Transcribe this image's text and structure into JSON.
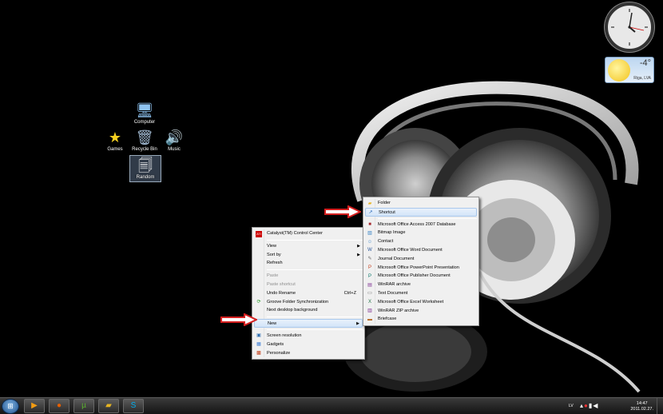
{
  "desktop": {
    "icons": [
      {
        "label": "Computer",
        "icon": "computer-icon"
      },
      {
        "label": "Games",
        "icon": "star-icon"
      },
      {
        "label": "Recycle Bin",
        "icon": "recycle-bin-icon"
      },
      {
        "label": "Music",
        "icon": "speaker-icon"
      },
      {
        "label": "Random",
        "icon": "document-stack-icon"
      }
    ]
  },
  "gadgets": {
    "weather": {
      "temperature": "-4°",
      "city": "Riga, LVA"
    }
  },
  "desktop_menu": {
    "items": [
      {
        "label": "Catalyst(TM) Control Center",
        "icon": "ati-icon"
      },
      {
        "label": "View"
      },
      {
        "label": "Sort by"
      },
      {
        "label": "Refresh"
      },
      {
        "label": "Paste"
      },
      {
        "label": "Paste shortcut"
      },
      {
        "label": "Undo Rename",
        "shortcut": "Ctrl+Z"
      },
      {
        "label": "Groove Folder Synchronization",
        "icon": "groove-icon"
      },
      {
        "label": "Next desktop background"
      },
      {
        "label": "New"
      },
      {
        "label": "Screen resolution",
        "icon": "display-icon"
      },
      {
        "label": "Gadgets",
        "icon": "gadgets-icon"
      },
      {
        "label": "Personalize",
        "icon": "personalize-icon"
      }
    ]
  },
  "new_menu": {
    "items": [
      {
        "label": "Folder",
        "icon": "folder-icon"
      },
      {
        "label": "Shortcut",
        "icon": "shortcut-icon"
      },
      {
        "label": "Microsoft Office Access 2007 Database",
        "icon": "access-icon"
      },
      {
        "label": "Bitmap Image",
        "icon": "bitmap-icon"
      },
      {
        "label": "Contact",
        "icon": "contact-icon"
      },
      {
        "label": "Microsoft Office Word Document",
        "icon": "word-icon"
      },
      {
        "label": "Journal Document",
        "icon": "journal-icon"
      },
      {
        "label": "Microsoft Office PowerPoint Presentation",
        "icon": "powerpoint-icon"
      },
      {
        "label": "Microsoft Office Publisher Document",
        "icon": "publisher-icon"
      },
      {
        "label": "WinRAR archive",
        "icon": "winrar-icon"
      },
      {
        "label": "Text Document",
        "icon": "text-icon"
      },
      {
        "label": "Microsoft Office Excel Worksheet",
        "icon": "excel-icon"
      },
      {
        "label": "WinRAR ZIP archive",
        "icon": "zip-icon"
      },
      {
        "label": "Briefcase",
        "icon": "briefcase-icon"
      }
    ]
  },
  "taskbar": {
    "language": "LV",
    "time": "14:47",
    "date": "2011.02.27."
  },
  "colors": {
    "highlight": "#d2e4f8",
    "arrow": "#d41f1f"
  }
}
